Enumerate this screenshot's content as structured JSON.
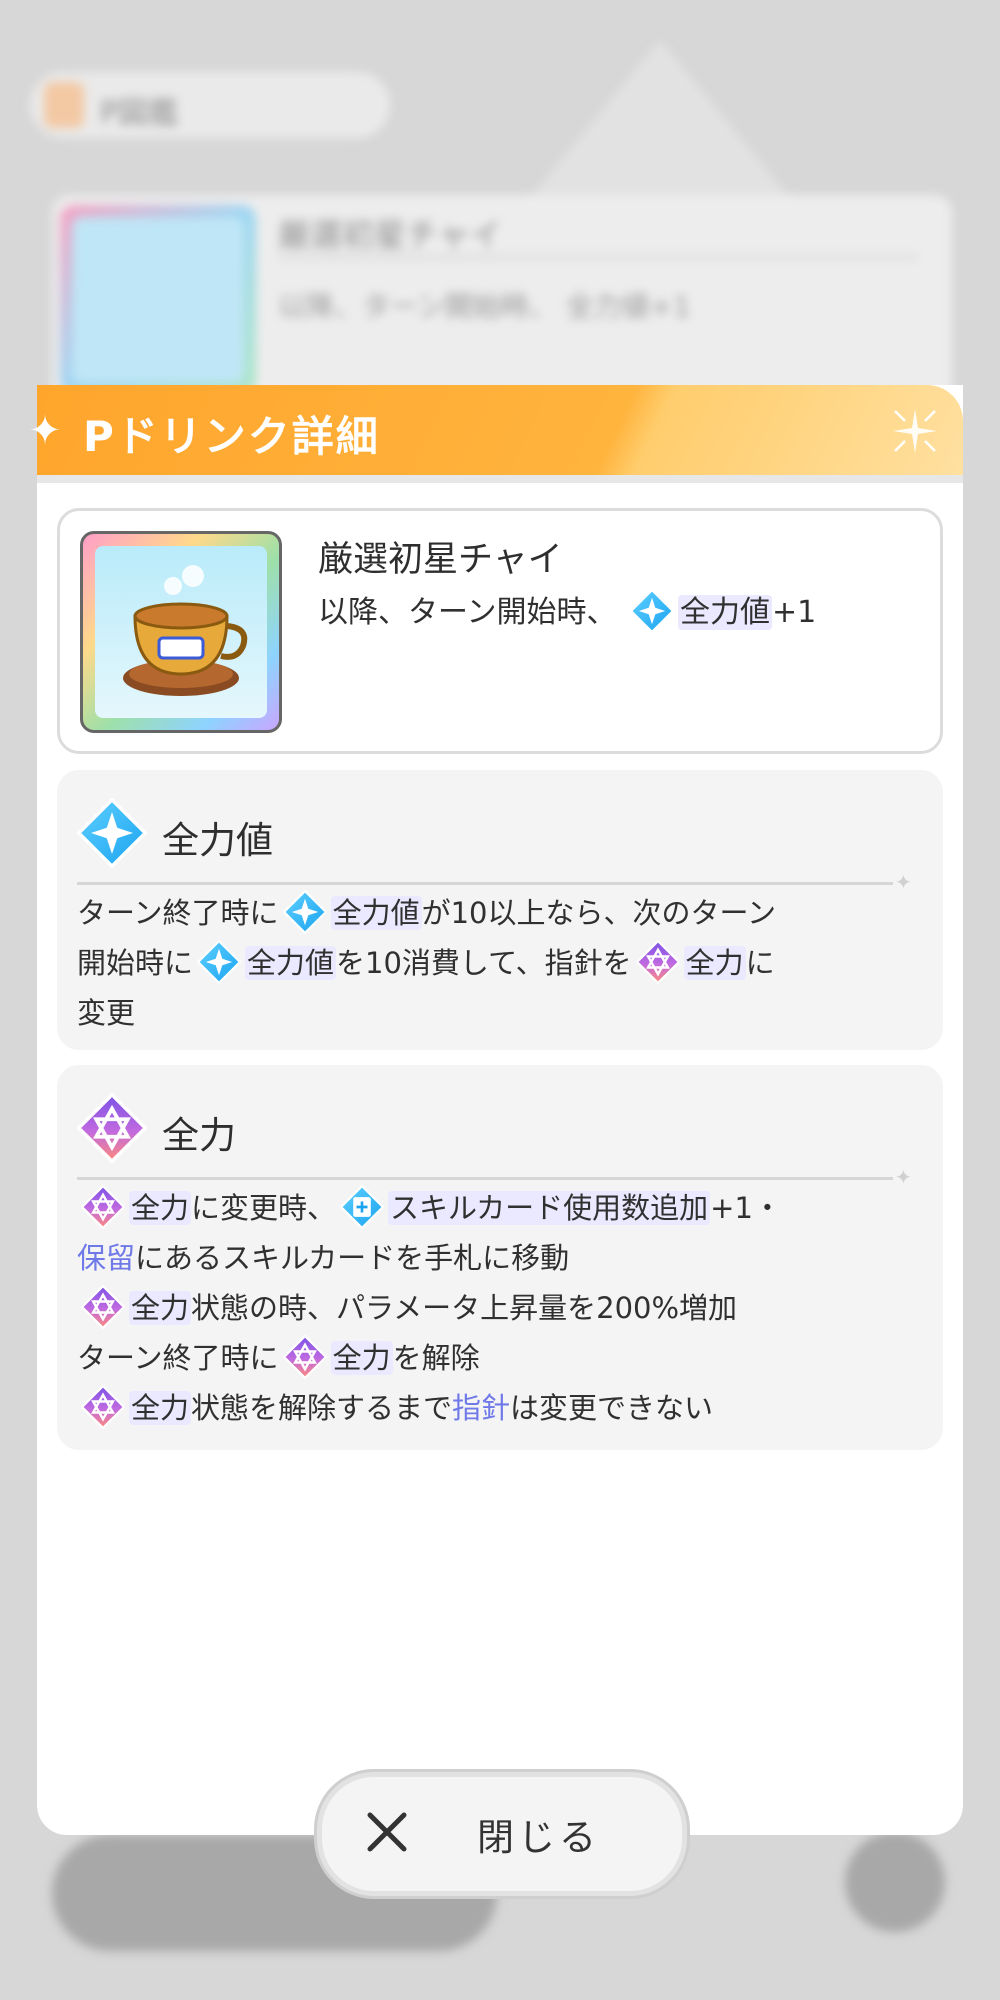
{
  "background": {
    "pill_label": "P図鑑",
    "card_title": "厳選初星チャイ",
    "card_desc": "以降、ターン開始時、 全力値+1"
  },
  "modal": {
    "title": "Pドリンク詳細"
  },
  "item": {
    "name": "厳選初星チャイ",
    "desc_prefix": "以降、ターン開始時、",
    "desc_keyword": "全力値",
    "desc_suffix": "+1"
  },
  "panel_zenryokuchi": {
    "title": "全力値",
    "line1_a": "ターン終了時に",
    "line1_kw": "全力値",
    "line1_b": "が10以上なら、次のターン",
    "line2_a": "開始時に",
    "line2_kw": "全力値",
    "line2_b": "を10消費して、指針を",
    "line2_kw2": "全力",
    "line2_c": "に",
    "line3": "変更"
  },
  "panel_zenryoku": {
    "title": "全力",
    "l1_kw": "全力",
    "l1_a": "に変更時、",
    "l1_kw2": "スキルカード使用数追加",
    "l1_b": "+1・",
    "l2_link": "保留",
    "l2_a": "にあるスキルカードを手札に移動",
    "l3_kw": "全力",
    "l3_a": "状態の時、パラメータ上昇量を200%増加",
    "l4_a": "ターン終了時に",
    "l4_kw": "全力",
    "l4_b": "を解除",
    "l5_kw": "全力",
    "l5_a": "状態を解除するまで",
    "l5_link": "指針",
    "l5_b": "は変更できない"
  },
  "close_button": {
    "label": "閉じる"
  },
  "icons": {
    "zenryokuchi": "blue-diamond-star-icon",
    "zenryoku": "purple-diamond-star-icon",
    "skill_card_plus": "blue-diamond-card-plus-icon"
  },
  "colors": {
    "header_orange": "#ffa52c",
    "keyword_bg": "#ebe9ff",
    "link_blue": "#6f79e8"
  }
}
